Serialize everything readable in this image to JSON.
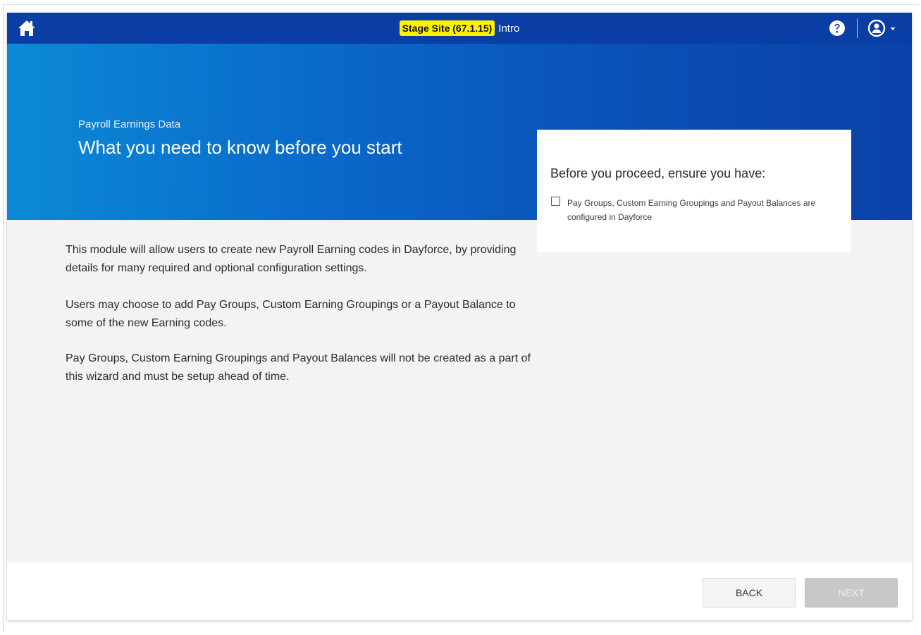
{
  "topbar": {
    "stage_badge": "Stage Site (67.1.15)",
    "page_name": "Intro",
    "icons": [
      "home-icon",
      "help-icon",
      "user-icon",
      "caret-down-icon"
    ]
  },
  "hero": {
    "subtitle": "Payroll Earnings Data",
    "title": "What you need to know before you start"
  },
  "checklist_card": {
    "title": "Before you proceed, ensure you have:",
    "items": [
      {
        "label": "Pay Groups, Custom Earning Groupings and Payout Balances are configured in Dayforce",
        "checked": false
      }
    ]
  },
  "content": {
    "paragraphs": [
      "This module will allow users to create new Payroll Earning codes in Dayforce, by providing details for many required and optional configuration settings.",
      "Users may choose to add Pay Groups, Custom Earning Groupings or a Payout Balance to some of the new Earning codes.",
      "Pay Groups, Custom Earning Groupings and Payout Balances will not be created as a part of this wizard and must be setup ahead of time."
    ]
  },
  "footer": {
    "back_label": "BACK",
    "next_label": "NEXT",
    "next_enabled": false
  },
  "colors": {
    "topbar": "#0a3ea5",
    "hero_start": "#0b8ad6",
    "hero_end": "#0a41a8",
    "stage_badge": "#fff200",
    "page_bg": "#f3f3f3"
  }
}
